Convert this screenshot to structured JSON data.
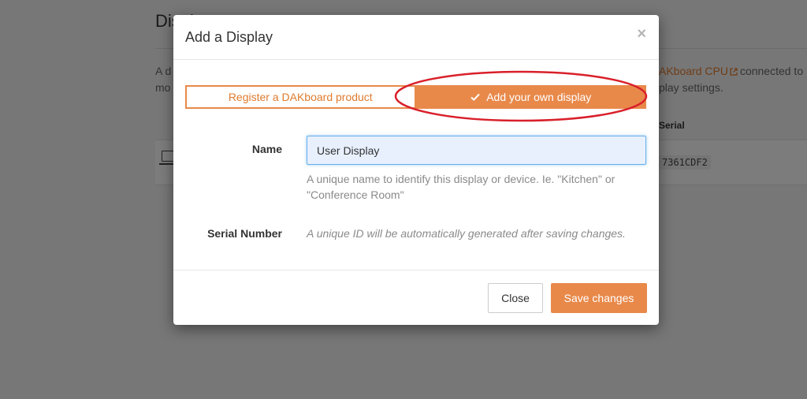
{
  "background": {
    "title": "Displays",
    "left_text_line1": "A d",
    "left_text_line2": "mo",
    "link_text": "AKboard CPU",
    "connected_text": "connected to",
    "line2_text": "play settings.",
    "serial_header": "Serial",
    "serial_value": "7361CDF2"
  },
  "modal": {
    "title": "Add a Display",
    "close_symbol": "×",
    "toggle": {
      "register_label": "Register a DAKboard product",
      "own_label": "Add your own display"
    },
    "name_field": {
      "label": "Name",
      "value": "User Display",
      "help": "A unique name to identify this display or device. Ie. \"Kitchen\" or \"Conference Room\""
    },
    "serial_field": {
      "label": "Serial Number",
      "help": "A unique ID will be automatically generated after saving changes."
    },
    "footer": {
      "close_label": "Close",
      "save_label": "Save changes"
    }
  },
  "colors": {
    "accent": "#e8894a",
    "annotation": "#d9202a",
    "focus": "#66afe9"
  },
  "icons": [
    "check-icon",
    "external-link-icon",
    "device-icon",
    "close-icon"
  ]
}
